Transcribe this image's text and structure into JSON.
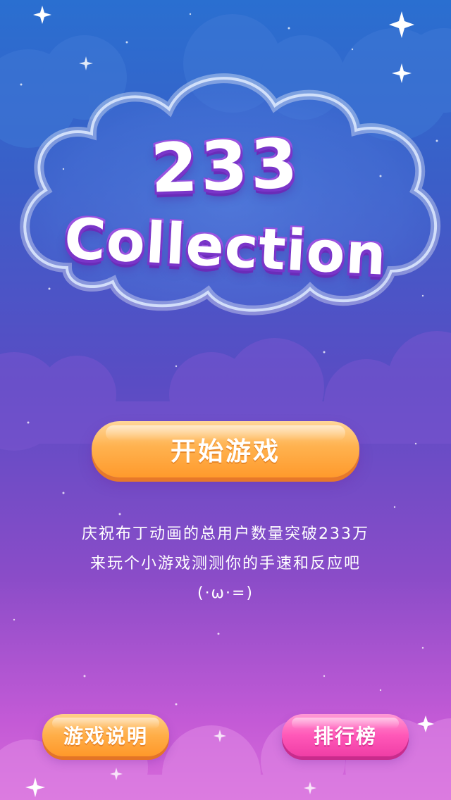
{
  "title": {
    "main": "233",
    "sub": "Collection"
  },
  "start_button": {
    "label": "开始游戏"
  },
  "description": {
    "line1": "庆祝布丁动画的总用户数量突破233万",
    "line2": "来玩个小游戏测测你的手速和反应吧",
    "line3": "(·ω·=)"
  },
  "bottom_buttons": {
    "rules_label": "游戏说明",
    "rank_label": "排行榜"
  },
  "colors": {
    "bg_top": "#2a6fd0",
    "bg_bottom": "#d86ada",
    "start_button": "#ffb24f",
    "rules_button": "#ffae48",
    "rank_button": "#ff58b8",
    "title_outline": "#8b3fd4"
  },
  "icons": [
    "sparkle-icon"
  ]
}
